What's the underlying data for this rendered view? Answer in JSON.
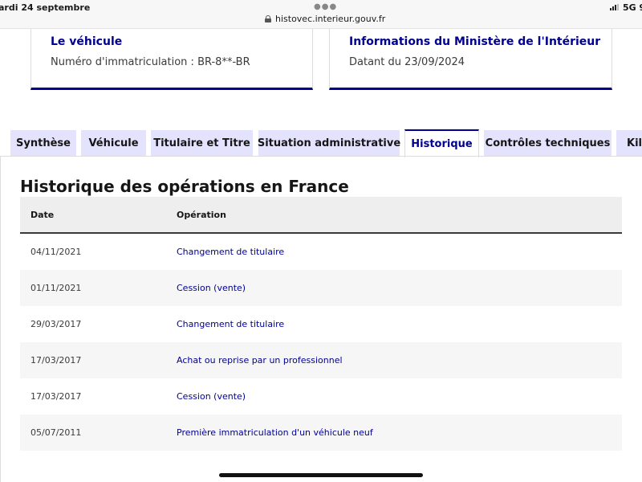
{
  "status_bar": {
    "date": "ardi 24 septembre",
    "url": "histovec.interieur.gouv.fr",
    "network": "5G 9"
  },
  "cards": {
    "vehicle": {
      "title": "Le véhicule",
      "text": "Numéro d'immatriculation : BR-8**-BR"
    },
    "ministry": {
      "title": "Informations du Ministère de l'Intérieur",
      "text": "Datant du 23/09/2024"
    }
  },
  "tabs": [
    {
      "label": "Synthèse",
      "active": false
    },
    {
      "label": "Véhicule",
      "active": false
    },
    {
      "label": "Titulaire et Titre",
      "active": false
    },
    {
      "label": "Situation administrative",
      "active": false
    },
    {
      "label": "Historique",
      "active": true
    },
    {
      "label": "Contrôles techniques",
      "active": false
    },
    {
      "label": "Kil",
      "active": false
    }
  ],
  "history": {
    "title": "Historique des opérations en France",
    "columns": {
      "date": "Date",
      "operation": "Opération"
    },
    "rows": [
      {
        "date": "04/11/2021",
        "operation": "Changement de titulaire"
      },
      {
        "date": "01/11/2021",
        "operation": "Cession (vente)"
      },
      {
        "date": "29/03/2017",
        "operation": "Changement de titulaire"
      },
      {
        "date": "17/03/2017",
        "operation": "Achat ou reprise par un professionnel"
      },
      {
        "date": "17/03/2017",
        "operation": "Cession (vente)"
      },
      {
        "date": "05/07/2011",
        "operation": "Première immatriculation d'un véhicule neuf"
      }
    ]
  },
  "colors": {
    "brand_blue": "#000091",
    "tab_bg": "#e3e3fd"
  }
}
